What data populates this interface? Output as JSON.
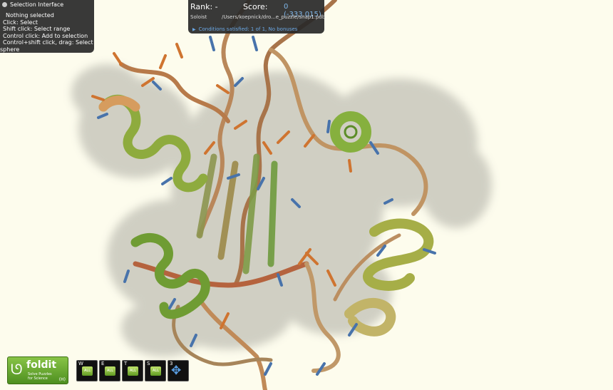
{
  "selection_panel": {
    "title": "Selection Interface",
    "lines": [
      "Nothing selected",
      "Click: Select",
      "Shift click: Select range",
      "Control click: Add to selection",
      "Control+shift click, drag: Select",
      "sphere"
    ]
  },
  "score_panel": {
    "rank": "Rank: -",
    "score_label": "Score:",
    "score_value": "0 (-333.015)",
    "mode": "Soloist",
    "file": "/Users/koepnick/dro...e_puzzle/snap1.pdb",
    "conditions": "Conditions satisfied: 1 of 1, No bonuses"
  },
  "logo": {
    "name": "foldit",
    "tagline_1": "Solve Puzzles",
    "tagline_2": "for Science",
    "version": "(H)"
  },
  "toolbar": {
    "tools": [
      {
        "key": "W",
        "icon": "wiggle-icon"
      },
      {
        "key": "E",
        "icon": "shake-icon"
      },
      {
        "key": "T",
        "icon": "tweak-icon"
      },
      {
        "key": "S",
        "icon": "rebuild-icon"
      },
      {
        "key": "3",
        "icon": "move-icon"
      }
    ]
  },
  "colors": {
    "background": "#fdfced",
    "helix": "#7ca83a",
    "sidechain_hydrophobic": "#d07a2e",
    "sidechain_polar": "#4a78b0",
    "density_cloud": "#b8b8b0"
  }
}
